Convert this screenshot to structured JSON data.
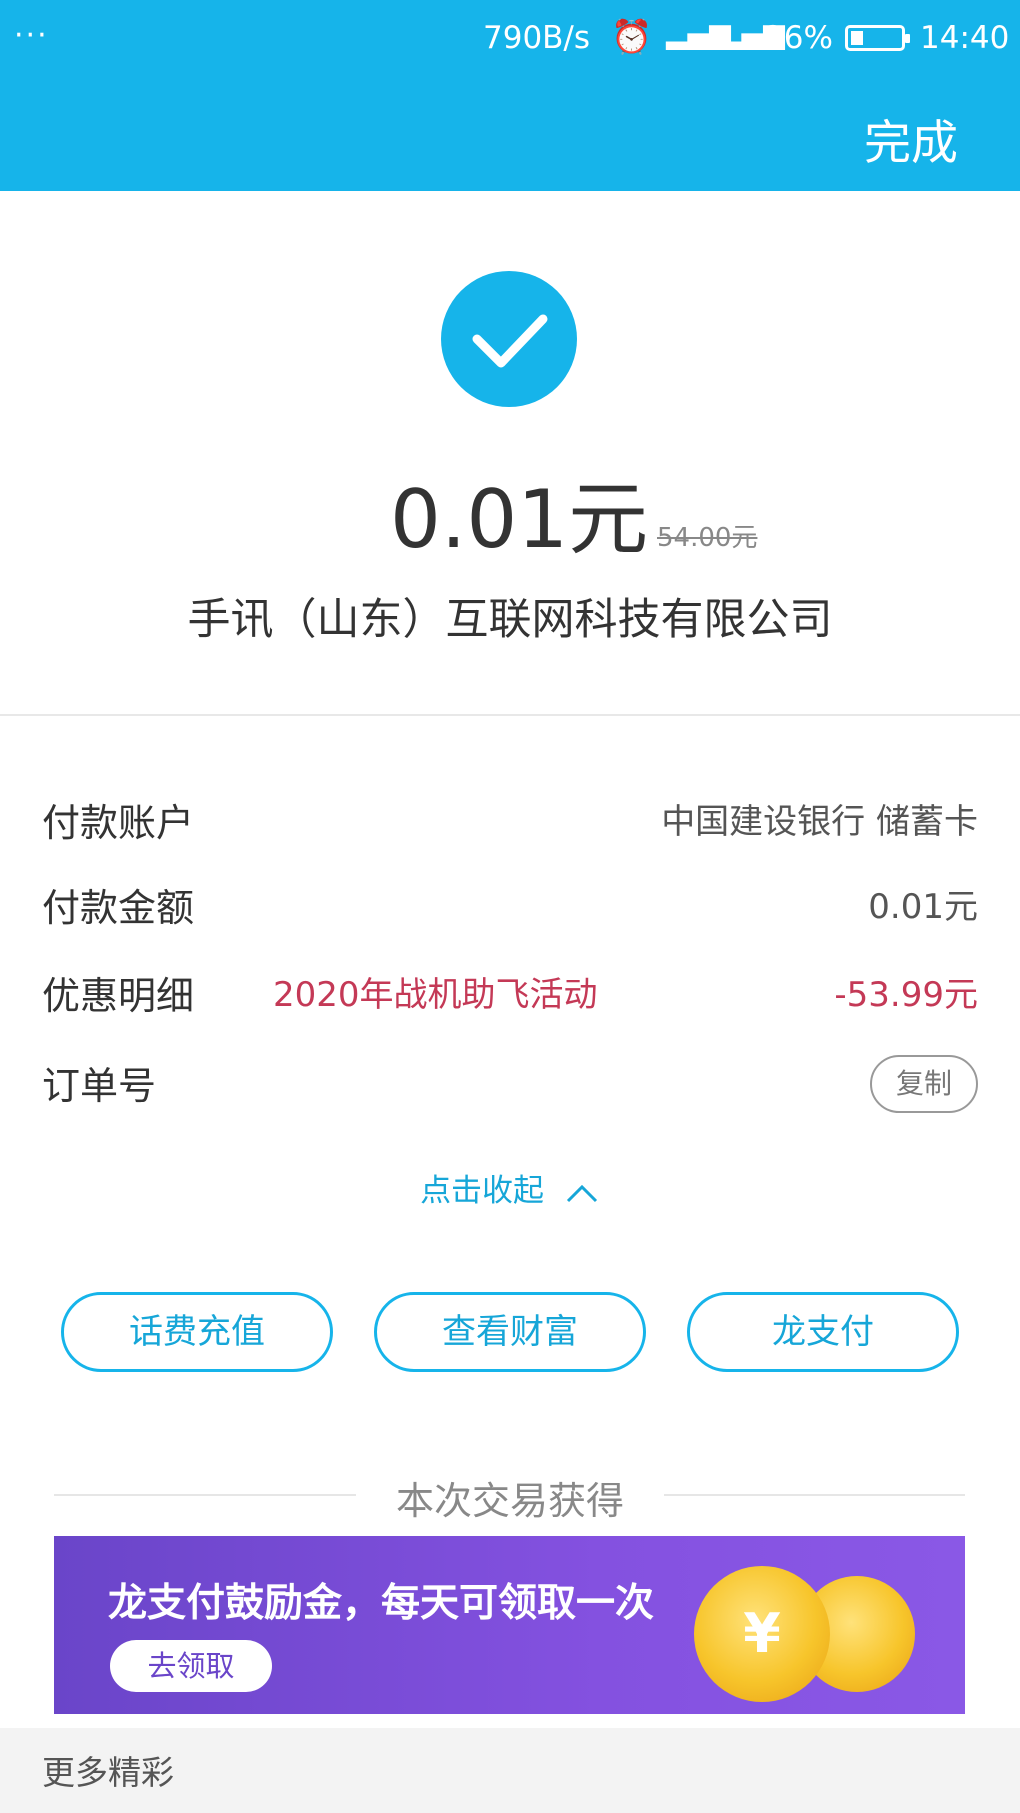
{
  "status_bar": {
    "menu": "···",
    "net_speed": "790B/s",
    "alarm_icon": "alarm-clock-icon",
    "signal_1": "4G",
    "signal_2": "2G",
    "battery_pct": "26%",
    "battery_level": 0.26,
    "time": "14:40"
  },
  "header": {
    "done_label": "完成"
  },
  "result": {
    "icon": "checkmark-icon",
    "amount": "0.01元",
    "original_amount": "54.00元",
    "merchant": "手讯（山东）互联网科技有限公司"
  },
  "details": {
    "pay_account_label": "付款账户",
    "pay_account_value": "中国建设银行 储蓄卡",
    "pay_amount_label": "付款金额",
    "pay_amount_value": "0.01元",
    "discount_label": "优惠明细",
    "discount_activity": "2020年战机助飞活动",
    "discount_value": "-53.99元",
    "order_label": "订单号",
    "copy_label": "复制",
    "collapse_label": "点击收起"
  },
  "actions": [
    {
      "label": "话费充值"
    },
    {
      "label": "查看财富"
    },
    {
      "label": "龙支付"
    }
  ],
  "earned": {
    "title": "本次交易获得",
    "banner_text": "龙支付鼓励金，每天可领取一次",
    "banner_button": "去领取",
    "coin_symbol": "¥"
  },
  "more": {
    "label": "更多精彩"
  },
  "colors": {
    "accent": "#16b4ea",
    "discount_red": "#c43956",
    "banner_purple": "#7a4ddb"
  }
}
